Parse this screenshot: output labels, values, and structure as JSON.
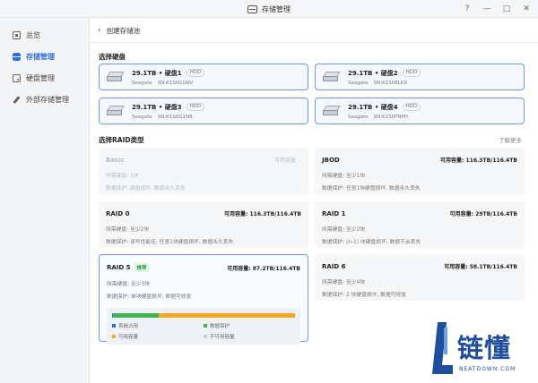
{
  "window": {
    "title": "存储管理",
    "controls": [
      "?",
      "—",
      "□",
      "✕"
    ]
  },
  "sidebar": {
    "items": [
      {
        "label": "总览",
        "icon": "overview-icon",
        "active": false
      },
      {
        "label": "存储管理",
        "icon": "storage-icon",
        "active": true
      },
      {
        "label": "硬盘管理",
        "icon": "disk-icon",
        "active": false
      },
      {
        "label": "外部存储管理",
        "icon": "external-storage-icon",
        "active": false
      }
    ]
  },
  "main": {
    "breadcrumb": "创建存储池",
    "select_disk_title": "选择硬盘",
    "disks": [
      {
        "name": "29.1TB • 硬盘1",
        "type": "HDD",
        "vendor": "Seagate",
        "sn": "SN:K1S0GLWV"
      },
      {
        "name": "29.1TB • 硬盘2",
        "type": "HDD",
        "vendor": "Seagate",
        "sn": "SN:K1S0ELKX"
      },
      {
        "name": "29.1TB • 硬盘3",
        "type": "HDD",
        "vendor": "Seagate",
        "sn": "SN:K1S0G1N8"
      },
      {
        "name": "29.1TB • 硬盘4",
        "type": "HDD",
        "vendor": "Seagate",
        "sn": "SN:K1S0FNPH"
      }
    ],
    "raid_title": "选择RAID类型",
    "learn_more": "了解更多",
    "raids": [
      {
        "name": "Basic",
        "capacity": "可用容量: -",
        "req": "所需硬盘: 1块",
        "prot": "数据保护: 硬盘损坏, 数据永久丢失",
        "disabled": true
      },
      {
        "name": "JBOD",
        "capacity": "可用容量: 116.3TB/116.4TB",
        "req": "所需硬盘: 至少1块",
        "prot": "数据保护: 任意1块硬盘损坏, 数据永久丢失",
        "disabled": false
      },
      {
        "name": "RAID 0",
        "capacity": "可用容量: 116.3TB/116.4TB",
        "req": "所需硬盘: 至少2块",
        "prot": "数据保护: 读写性能佳, 任意1块硬盘损坏, 数据永久丢失",
        "disabled": false
      },
      {
        "name": "RAID 1",
        "capacity": "可用容量: 29TB/116.4TB",
        "req": "所需硬盘: 至少2块",
        "prot": "数据保护: (n-1) 块硬盘损坏, 数据不会丢失",
        "disabled": false
      },
      {
        "name": "RAID 5",
        "tag": "推荐",
        "capacity": "可用容量: 87.2TB/116.4TB",
        "req": "所需硬盘: 至少3块",
        "prot": "数据保护: 单块硬盘损坏, 数据可修复",
        "disabled": false,
        "selected": true
      },
      {
        "name": "RAID 6",
        "capacity": "可用容量: 58.1TB/116.4TB",
        "req": "所需硬盘: 至少4块",
        "prot": "数据保护: 2 块硬盘损坏, 数据可修复",
        "disabled": false
      }
    ],
    "usage": {
      "fractions": {
        "system": 0.003,
        "protection": 0.25,
        "available": 0.747,
        "unavailable": 0.0
      },
      "colors": {
        "system": "#2b6fde",
        "protection": "#3fb34f",
        "available": "#f5a623",
        "unavailable": "#c9ced6"
      },
      "legend": {
        "system": "系统占用",
        "protection": "数据保护",
        "available": "可用容量",
        "unavailable": "不可用容量"
      }
    }
  },
  "watermark": {
    "cn": "链懂",
    "en": "NEATDOWN.COM"
  }
}
